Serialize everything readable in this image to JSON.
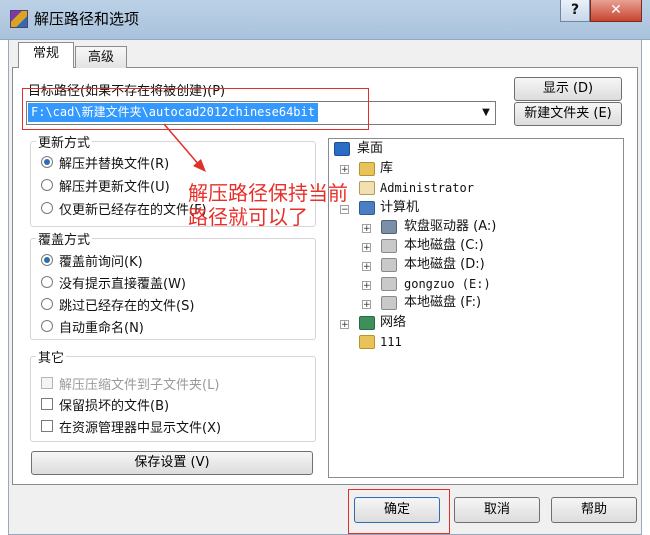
{
  "window": {
    "title": "解压路径和选项",
    "help_button": "?",
    "close_button": "✕"
  },
  "tabs": [
    {
      "label": "常规",
      "active": true
    },
    {
      "label": "高级",
      "active": false
    }
  ],
  "destination": {
    "label": "目标路径(如果不存在将被创建)(P)",
    "value": "F:\\cad\\新建文件夹\\autocad2012chinese64bit",
    "show_button": "显示 (D)",
    "new_folder_button": "新建文件夹 (E)"
  },
  "update_mode": {
    "title": "更新方式",
    "options": [
      {
        "label": "解压并替换文件(R)",
        "selected": true
      },
      {
        "label": "解压并更新文件(U)",
        "selected": false
      },
      {
        "label": "仅更新已经存在的文件(F)",
        "selected": false
      }
    ]
  },
  "overwrite_mode": {
    "title": "覆盖方式",
    "options": [
      {
        "label": "覆盖前询问(K)",
        "selected": true
      },
      {
        "label": "没有提示直接覆盖(W)",
        "selected": false
      },
      {
        "label": "跳过已经存在的文件(S)",
        "selected": false
      },
      {
        "label": "自动重命名(N)",
        "selected": false
      }
    ]
  },
  "misc": {
    "title": "其它",
    "options": [
      {
        "label": "解压压缩文件到子文件夹(L)",
        "checked": false,
        "disabled": true
      },
      {
        "label": "保留损坏的文件(B)",
        "checked": false,
        "disabled": false
      },
      {
        "label": "在资源管理器中显示文件(X)",
        "checked": false,
        "disabled": false
      }
    ]
  },
  "save_settings_button": "保存设置 (V)",
  "tree": {
    "items": [
      {
        "label": "桌面",
        "icon": "desktop-icon"
      },
      {
        "label": "库",
        "icon": "library-folder-icon"
      },
      {
        "label": "Administrator",
        "icon": "user-folder-icon"
      },
      {
        "label": "计算机",
        "icon": "computer-icon"
      },
      {
        "label": "软盘驱动器 (A:)",
        "icon": "floppy-drive-icon"
      },
      {
        "label": "本地磁盘 (C:)",
        "icon": "system-drive-icon"
      },
      {
        "label": "本地磁盘 (D:)",
        "icon": "local-drive-icon"
      },
      {
        "label": "gongzuo (E:)",
        "icon": "local-drive-icon"
      },
      {
        "label": "本地磁盘 (F:)",
        "icon": "local-drive-icon"
      },
      {
        "label": "网络",
        "icon": "network-icon"
      },
      {
        "label": "111",
        "icon": "folder-icon"
      }
    ]
  },
  "annotation": {
    "line1": "解压路径保持当前",
    "line2": "路径就可以了"
  },
  "footer": {
    "ok": "确定",
    "cancel": "取消",
    "help": "帮助"
  },
  "colors": {
    "highlight_red": "#e0302a",
    "selection_blue": "#3399ff"
  }
}
